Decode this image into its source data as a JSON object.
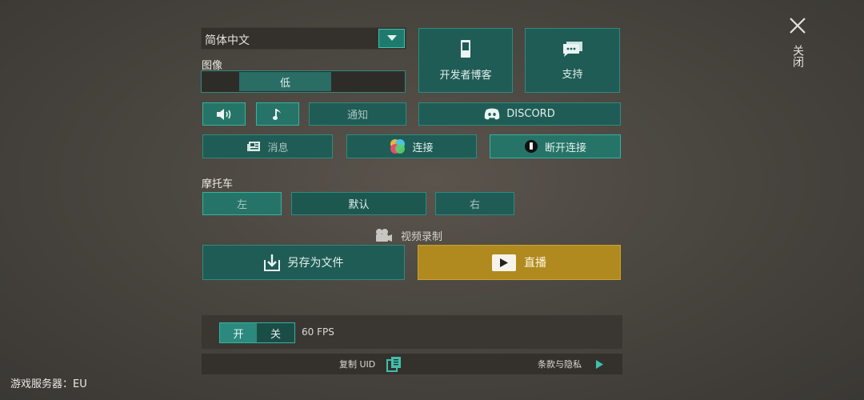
{
  "language": {
    "selected": "简体中文"
  },
  "image": {
    "label": "图像",
    "quality_selected": "低"
  },
  "top_buttons": {
    "dev_blog": "开发者博客",
    "support": "支持"
  },
  "audio": {
    "notifications": "通知",
    "discord": "DISCORD"
  },
  "links": {
    "messages": "消息",
    "connect": "连接",
    "disconnect": "断开连接"
  },
  "motorcycle": {
    "label": "摩托车",
    "left": "左",
    "default": "默认",
    "right": "右"
  },
  "video": {
    "label": "视频录制",
    "save_file": "另存为文件",
    "live": "直播"
  },
  "fps": {
    "on": "开",
    "off": "关",
    "value": "60 FPS"
  },
  "footer": {
    "copy_uid": "复制 UID",
    "terms": "条款与隐私"
  },
  "close": {
    "label": "关闭"
  },
  "server": {
    "text": "游戏服务器：EU"
  },
  "colors": {
    "accent": "#34b2a1",
    "button": "#1f5c55",
    "live": "#b08a1f"
  }
}
